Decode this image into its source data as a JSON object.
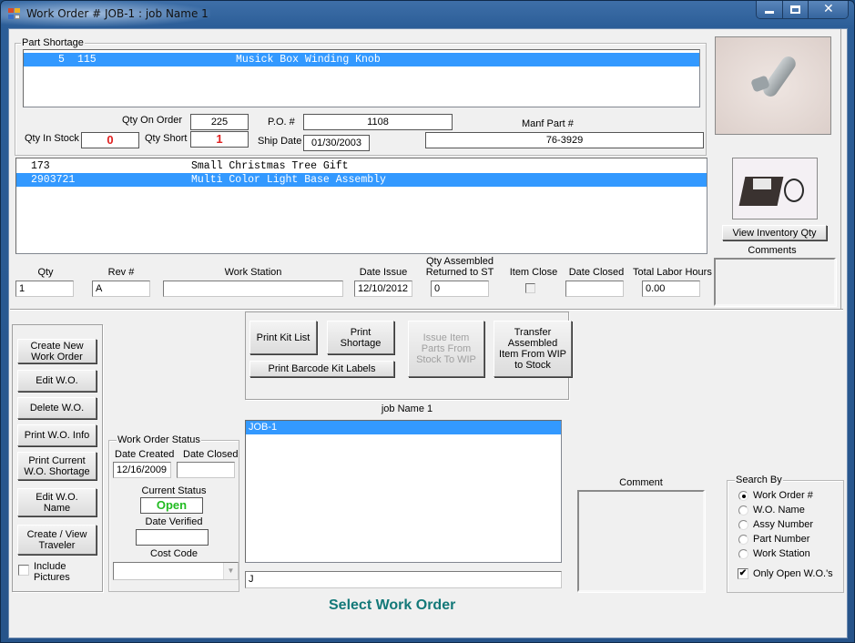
{
  "window": {
    "title": "Work Order # JOB-1 : job Name 1",
    "controls": {
      "minimize": "minimize-icon",
      "maximize": "maximize-icon",
      "close": "close-icon"
    }
  },
  "part_shortage": {
    "group_label": "Part Shortage",
    "rows": [
      {
        "qty": "5",
        "part": "115",
        "description": "Musick Box Winding Knob",
        "selected": true
      }
    ],
    "qty_on_order_label": "Qty On Order",
    "qty_on_order": "225",
    "qty_in_stock_label": "Qty In Stock",
    "qty_in_stock": "0",
    "qty_short_label": "Qty Short",
    "qty_short": "1",
    "po_label": "P.O. #",
    "po": "1108",
    "ship_date_label": "Ship Date",
    "ship_date": "01/30/2003",
    "manf_part_label": "Manf Part #",
    "manf_part": "76-3929"
  },
  "images": {
    "part_photo": "winding-knob-photo",
    "assembly_photo": "light-base-assembly-photo"
  },
  "assembly_list": {
    "rows": [
      {
        "number": "173",
        "description": "Small Christmas Tree Gift",
        "selected": false
      },
      {
        "number": "2903721",
        "description": "Multi Color Light Base Assembly",
        "selected": true
      }
    ]
  },
  "view_inventory_button": "View Inventory Qty",
  "comments_label": "Comments",
  "item_fields": {
    "qty_label": "Qty",
    "qty": "1",
    "rev_label": "Rev #",
    "rev": "A",
    "work_station_label": "Work Station",
    "work_station": "",
    "date_issue_label": "Date Issue",
    "date_issue": "12/10/2012",
    "qty_assembled_label_1": "Qty Assembled",
    "qty_assembled_label_2": "Returned to ST",
    "qty_assembled": "0",
    "item_close_label": "Item Close",
    "item_close_checked": false,
    "date_closed_label": "Date Closed",
    "date_closed": "",
    "labor_hours_label": "Total Labor Hours",
    "labor_hours": "0.00"
  },
  "left_buttons": [
    "Create New\nWork Order",
    "Edit W.O.",
    "Delete W.O.",
    "Print W.O. Info",
    "Print Current\nW.O. Shortage",
    "Edit W.O.\nName",
    "Create / View\nTraveler"
  ],
  "include_pictures": {
    "label_1": "Include",
    "label_2": "Pictures",
    "checked": false
  },
  "kit_buttons": {
    "print_kit_list": "Print Kit List",
    "print_shortage": "Print\nShortage",
    "print_barcode": "Print Barcode Kit Labels",
    "issue_item": "Issue Item\nParts From\nStock To WIP",
    "issue_item_enabled": false,
    "transfer": "Transfer\nAssembled\nItem From WIP\nto Stock"
  },
  "job_name_label": "job Name 1",
  "work_order_list": {
    "rows": [
      {
        "label": "JOB-1",
        "selected": true
      }
    ]
  },
  "search_input": {
    "value": "J"
  },
  "select_title": "Select Work Order",
  "work_order_status": {
    "group_label": "Work Order Status",
    "date_created_label": "Date Created",
    "date_created": "12/16/2009",
    "date_closed_label": "Date Closed",
    "date_closed": "",
    "current_status_label": "Current Status",
    "current_status": "Open",
    "current_status_color": "#22bb22",
    "date_verified_label": "Date Verified",
    "date_verified": "",
    "cost_code_label": "Cost Code",
    "cost_code": ""
  },
  "comment_label": "Comment",
  "search_by": {
    "group_label": "Search By",
    "options": [
      "Work Order #",
      "W.O. Name",
      "Assy Number",
      "Part Number",
      "Work Station"
    ],
    "selected_index": 0,
    "only_open_label": "Only Open W.O.'s",
    "only_open_checked": true
  },
  "colors": {
    "selection": "#3399ff",
    "title_accent": "#127878",
    "alert_red": "#e02020"
  }
}
